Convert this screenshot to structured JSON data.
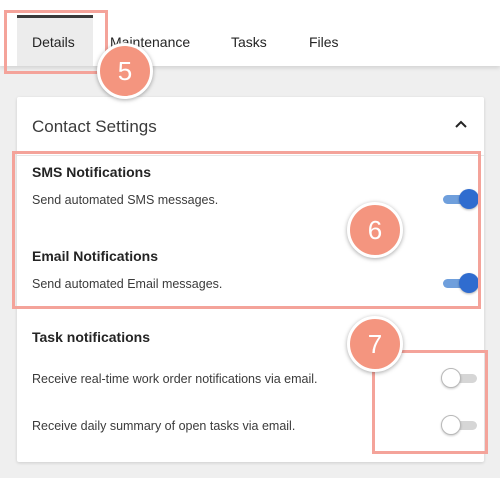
{
  "tabs": [
    {
      "label": "Details",
      "active": true
    },
    {
      "label": "Maintenance",
      "active": false
    },
    {
      "label": "Tasks",
      "active": false
    },
    {
      "label": "Files",
      "active": false
    }
  ],
  "card": {
    "title": "Contact Settings",
    "collapse_icon": "chevron-up-icon"
  },
  "sms": {
    "heading": "SMS Notifications",
    "description": "Send automated SMS messages.",
    "enabled": true
  },
  "email": {
    "heading": "Email Notifications",
    "description": "Send automated Email messages.",
    "enabled": true
  },
  "tasks": {
    "heading": "Task notifications",
    "realtime": {
      "description": "Receive real-time work order notifications via email.",
      "enabled": false
    },
    "summary": {
      "description": "Receive daily summary of open tasks via email.",
      "enabled": false
    }
  },
  "markers": [
    "5",
    "6",
    "7"
  ],
  "colors": {
    "toggle_on": "#2f6ccf",
    "highlight": "#f4a39a",
    "marker": "#f4957f"
  }
}
